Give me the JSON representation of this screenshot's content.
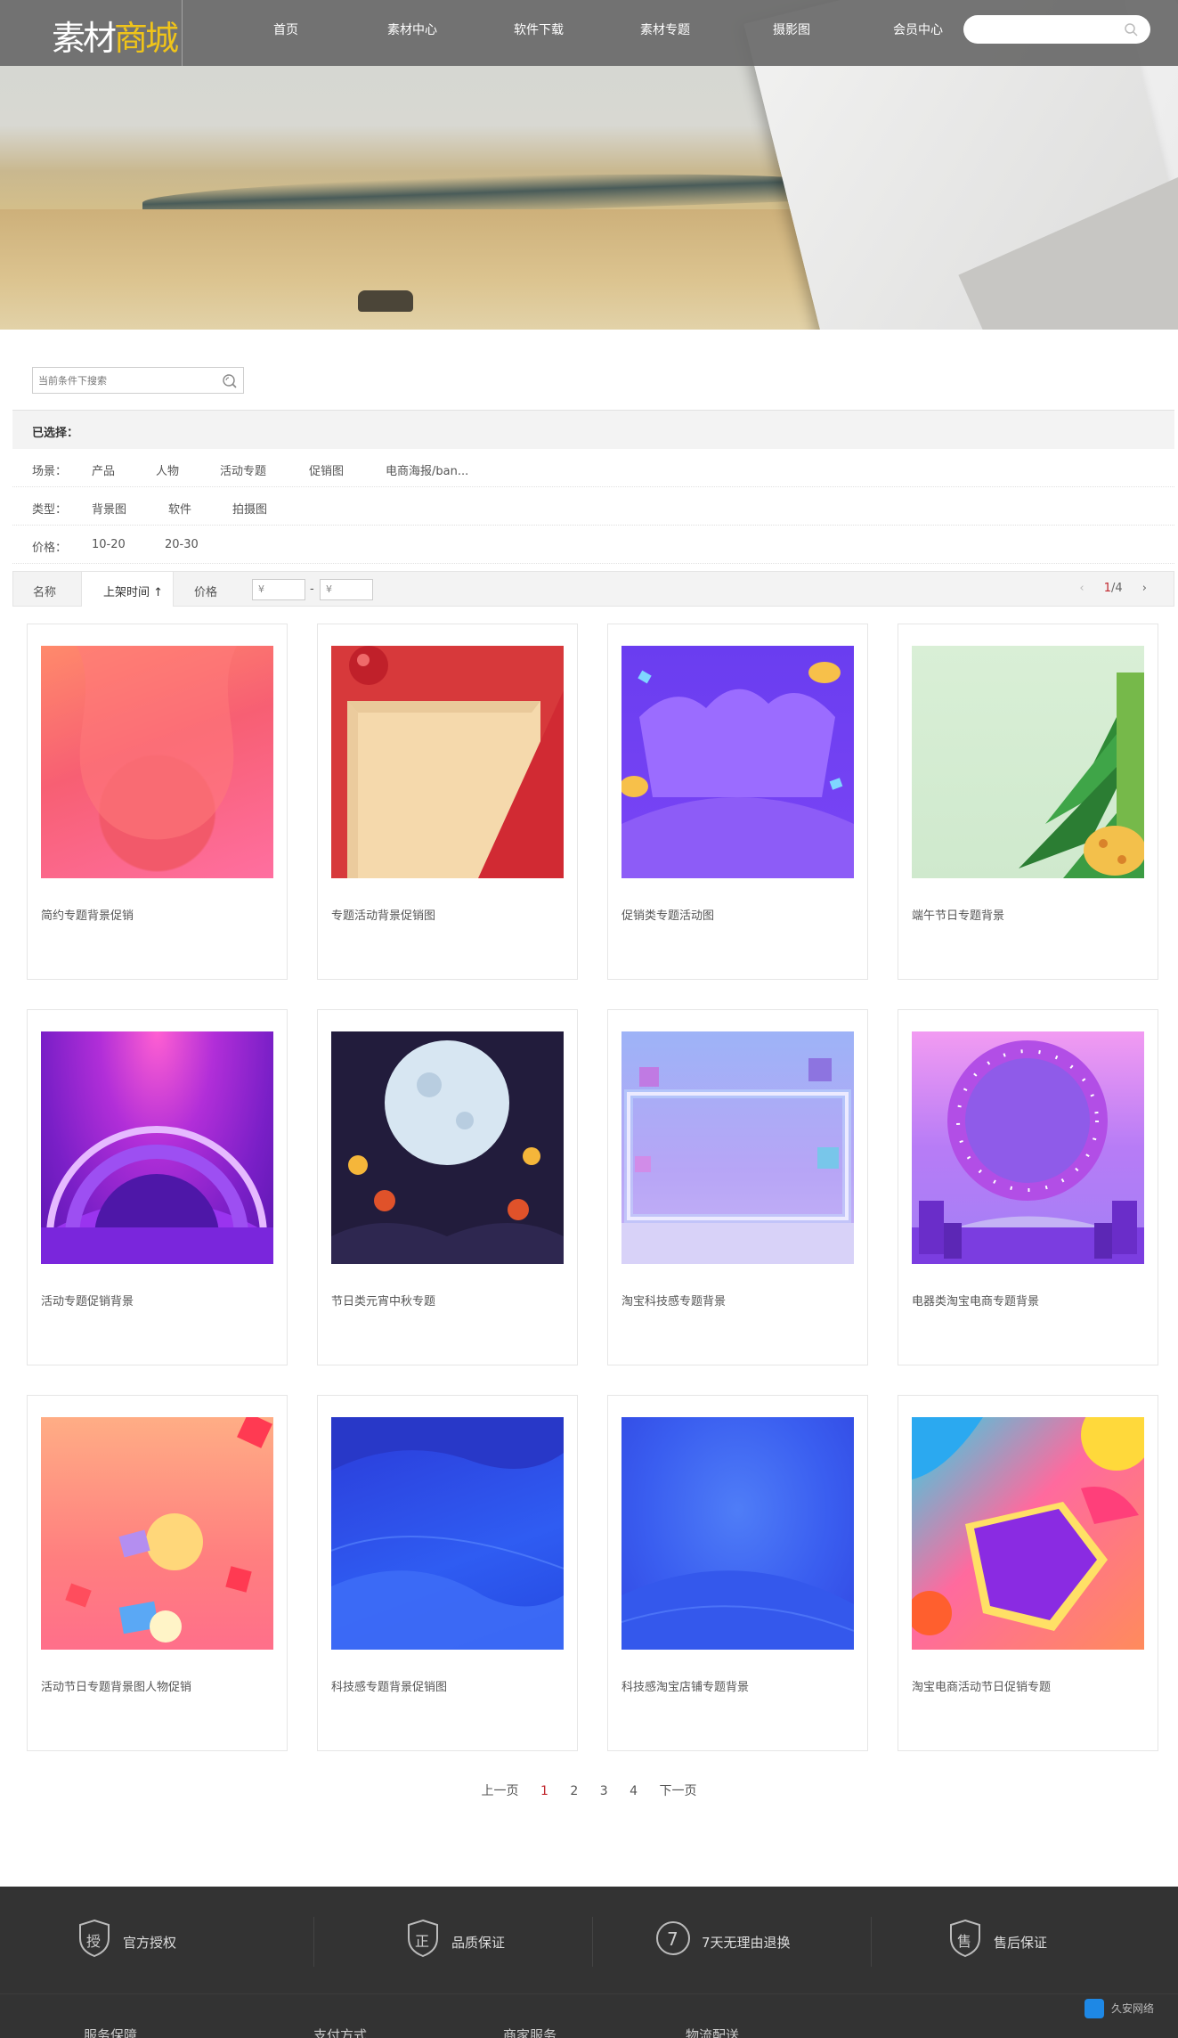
{
  "header": {
    "logo_part1": "素材",
    "logo_part2": "商城",
    "nav": [
      "首页",
      "素材中心",
      "软件下载",
      "素材专题",
      "摄影图",
      "会员中心"
    ]
  },
  "filter": {
    "search_placeholder": "当前条件下搜索",
    "selected_label": "已选择：",
    "rows": [
      {
        "label": "场景：",
        "options": [
          "产品",
          "人物",
          "活动专题",
          "促销图",
          "电商海报/ban..."
        ]
      },
      {
        "label": "类型：",
        "options": [
          "背景图",
          "软件",
          "拍摄图"
        ]
      },
      {
        "label": "价格：",
        "options": [
          "10-20",
          "20-30"
        ]
      }
    ]
  },
  "sort": {
    "name": "名称",
    "time": "上架时间 ↑",
    "price": "价格",
    "price_from": "¥",
    "price_sep": "-",
    "price_to": "¥",
    "page_current": "1",
    "page_total": "/4",
    "prev": "‹",
    "next": "›"
  },
  "products": [
    {
      "title": "简约专题背景促销"
    },
    {
      "title": "专题活动背景促销图"
    },
    {
      "title": "促销类专题活动图"
    },
    {
      "title": "端午节日专题背景"
    },
    {
      "title": "活动专题促销背景"
    },
    {
      "title": "节日类元宵中秋专题"
    },
    {
      "title": "淘宝科技感专题背景"
    },
    {
      "title": "电器类淘宝电商专题背景"
    },
    {
      "title": "活动节日专题背景图人物促销"
    },
    {
      "title": "科技感专题背景促销图"
    },
    {
      "title": "科技感淘宝店铺专题背景"
    },
    {
      "title": "淘宝电商活动节日促销专题"
    }
  ],
  "pagination": {
    "prev": "上一页",
    "pages": [
      "1",
      "2",
      "3",
      "4"
    ],
    "next": "下一页"
  },
  "footer": {
    "guarantees": [
      {
        "icon": "授",
        "text": "官方授权"
      },
      {
        "icon": "正",
        "text": "品质保证"
      },
      {
        "icon": "7",
        "text": "7天无理由退换"
      },
      {
        "icon": "售",
        "text": "售后保证"
      }
    ],
    "links": [
      "服务保障",
      "支付方式",
      "商家服务",
      "物流配送"
    ],
    "watermark": "久安网络"
  }
}
